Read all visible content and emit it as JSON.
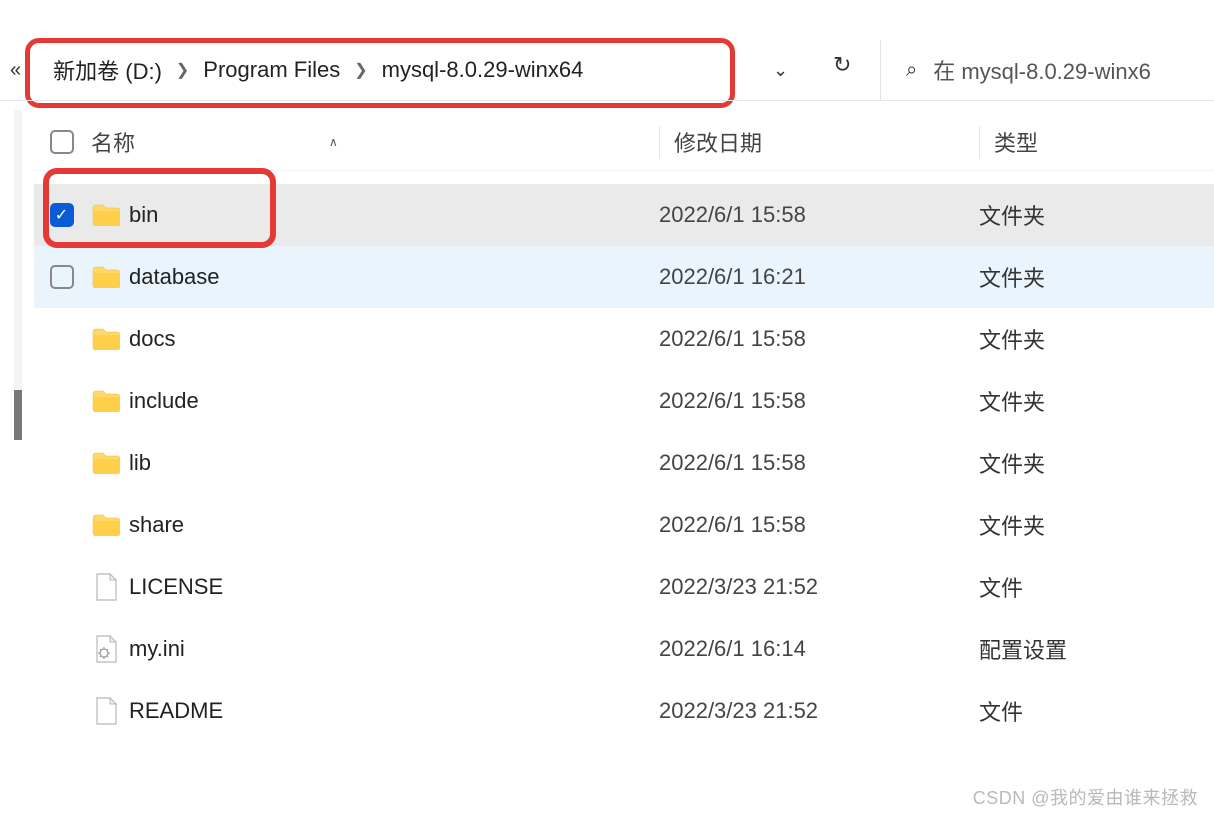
{
  "breadcrumbs": {
    "p0": "新加卷 (D:)",
    "p1": "Program Files",
    "p2": "mysql-8.0.29-winx64"
  },
  "search": {
    "placeholder": "在 mysql-8.0.29-winx6"
  },
  "headers": {
    "name": "名称",
    "date": "修改日期",
    "type": "类型"
  },
  "types": {
    "folder": "文件夹",
    "file": "文件",
    "config": "配置设置"
  },
  "rows": {
    "r0": {
      "name": "bin",
      "date": "2022/6/1 15:58"
    },
    "r1": {
      "name": "database",
      "date": "2022/6/1 16:21"
    },
    "r2": {
      "name": "docs",
      "date": "2022/6/1 15:58"
    },
    "r3": {
      "name": "include",
      "date": "2022/6/1 15:58"
    },
    "r4": {
      "name": "lib",
      "date": "2022/6/1 15:58"
    },
    "r5": {
      "name": "share",
      "date": "2022/6/1 15:58"
    },
    "r6": {
      "name": "LICENSE",
      "date": "2022/3/23 21:52"
    },
    "r7": {
      "name": "my.ini",
      "date": "2022/6/1 16:14"
    },
    "r8": {
      "name": "README",
      "date": "2022/3/23 21:52"
    }
  },
  "watermark": "CSDN @我的爱由谁来拯救"
}
